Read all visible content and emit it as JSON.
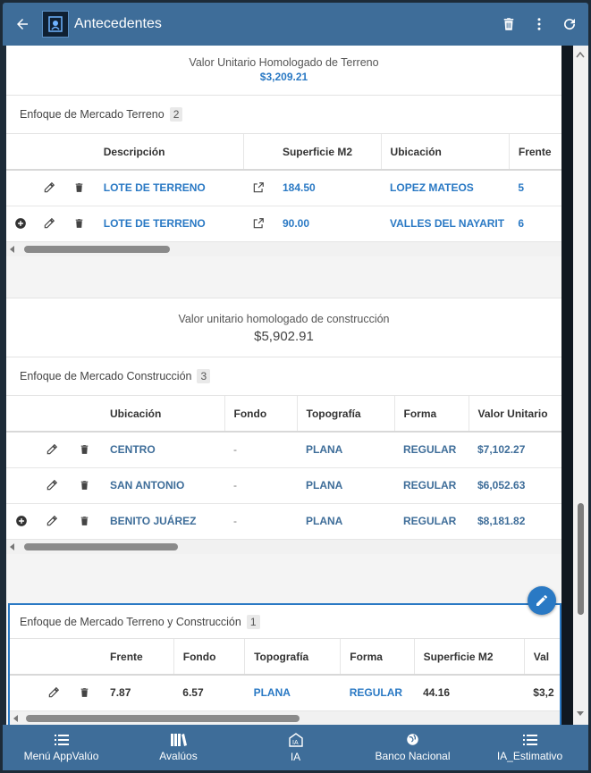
{
  "app_bar": {
    "title": "Antecedentes"
  },
  "terreno_homologado": {
    "label": "Valor Unitario Homologado de Terreno",
    "value": "$3,209.21"
  },
  "mercado_terreno": {
    "title": "Enfoque de Mercado Terreno",
    "count": "2",
    "columns": [
      "Descripción",
      "Superficie M2",
      "Ubicación",
      "Frente"
    ],
    "rows": [
      {
        "descripcion": "LOTE DE TERRENO",
        "superficie": "184.50",
        "ubicacion": "LOPEZ MATEOS",
        "frente": "5"
      },
      {
        "descripcion": "LOTE DE TERRENO",
        "superficie": "90.00",
        "ubicacion": "VALLES DEL NAYARIT",
        "frente": "6"
      }
    ]
  },
  "construccion_homologado": {
    "label": "Valor unitario homologado de construcción",
    "value": "$5,902.91"
  },
  "mercado_construccion": {
    "title": "Enfoque de Mercado Construcción",
    "count": "3",
    "columns": [
      "Ubicación",
      "Fondo",
      "Topografía",
      "Forma",
      "Valor Unitario"
    ],
    "rows": [
      {
        "ubicacion": "CENTRO",
        "fondo": "-",
        "topografia": "PLANA",
        "forma": "REGULAR",
        "valor": "$7,102.27"
      },
      {
        "ubicacion": "SAN ANTONIO",
        "fondo": "-",
        "topografia": "PLANA",
        "forma": "REGULAR",
        "valor": "$6,052.63"
      },
      {
        "ubicacion": "BENITO JUÁREZ",
        "fondo": "-",
        "topografia": "PLANA",
        "forma": "REGULAR",
        "valor": "$8,181.82"
      }
    ]
  },
  "mercado_terreno_construccion": {
    "title": "Enfoque de Mercado Terreno y Construcción",
    "count": "1",
    "columns": [
      "Frente",
      "Fondo",
      "Topografía",
      "Forma",
      "Superficie M2",
      "Val"
    ],
    "rows": [
      {
        "frente": "7.87",
        "fondo": "6.57",
        "topografia": "PLANA",
        "forma": "REGULAR",
        "superficie": "44.16",
        "val": "$3,2"
      }
    ]
  },
  "bottom_nav": [
    {
      "label": "Menú AppValúo",
      "icon": "list-icon"
    },
    {
      "label": "Avalúos",
      "icon": "books-icon"
    },
    {
      "label": "IA",
      "icon": "ia-icon"
    },
    {
      "label": "Banco Nacional",
      "icon": "globe-icon"
    },
    {
      "label": "IA_Estimativo",
      "icon": "list-icon"
    }
  ],
  "colors": {
    "primary": "#3e6d99",
    "link": "#2a79c4",
    "fab": "#2a79c4"
  }
}
